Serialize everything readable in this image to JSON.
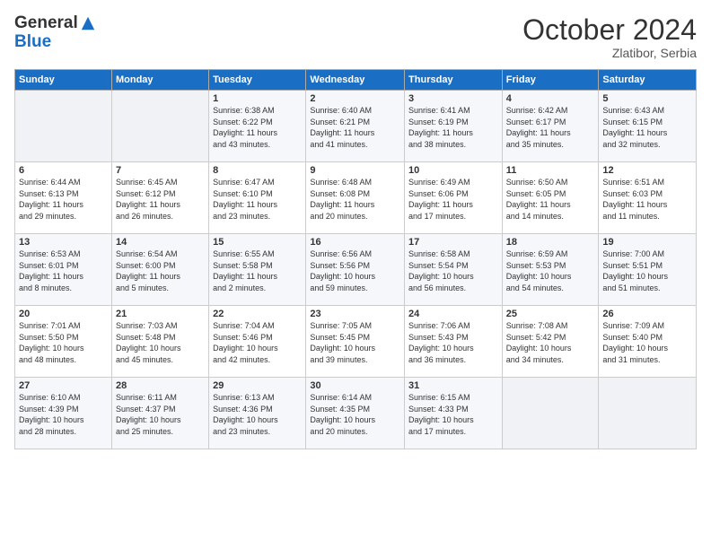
{
  "header": {
    "logo_line1": "General",
    "logo_line2": "Blue",
    "month": "October 2024",
    "location": "Zlatibor, Serbia"
  },
  "days_of_week": [
    "Sunday",
    "Monday",
    "Tuesday",
    "Wednesday",
    "Thursday",
    "Friday",
    "Saturday"
  ],
  "weeks": [
    [
      {
        "day": "",
        "info": ""
      },
      {
        "day": "",
        "info": ""
      },
      {
        "day": "1",
        "info": "Sunrise: 6:38 AM\nSunset: 6:22 PM\nDaylight: 11 hours\nand 43 minutes."
      },
      {
        "day": "2",
        "info": "Sunrise: 6:40 AM\nSunset: 6:21 PM\nDaylight: 11 hours\nand 41 minutes."
      },
      {
        "day": "3",
        "info": "Sunrise: 6:41 AM\nSunset: 6:19 PM\nDaylight: 11 hours\nand 38 minutes."
      },
      {
        "day": "4",
        "info": "Sunrise: 6:42 AM\nSunset: 6:17 PM\nDaylight: 11 hours\nand 35 minutes."
      },
      {
        "day": "5",
        "info": "Sunrise: 6:43 AM\nSunset: 6:15 PM\nDaylight: 11 hours\nand 32 minutes."
      }
    ],
    [
      {
        "day": "6",
        "info": "Sunrise: 6:44 AM\nSunset: 6:13 PM\nDaylight: 11 hours\nand 29 minutes."
      },
      {
        "day": "7",
        "info": "Sunrise: 6:45 AM\nSunset: 6:12 PM\nDaylight: 11 hours\nand 26 minutes."
      },
      {
        "day": "8",
        "info": "Sunrise: 6:47 AM\nSunset: 6:10 PM\nDaylight: 11 hours\nand 23 minutes."
      },
      {
        "day": "9",
        "info": "Sunrise: 6:48 AM\nSunset: 6:08 PM\nDaylight: 11 hours\nand 20 minutes."
      },
      {
        "day": "10",
        "info": "Sunrise: 6:49 AM\nSunset: 6:06 PM\nDaylight: 11 hours\nand 17 minutes."
      },
      {
        "day": "11",
        "info": "Sunrise: 6:50 AM\nSunset: 6:05 PM\nDaylight: 11 hours\nand 14 minutes."
      },
      {
        "day": "12",
        "info": "Sunrise: 6:51 AM\nSunset: 6:03 PM\nDaylight: 11 hours\nand 11 minutes."
      }
    ],
    [
      {
        "day": "13",
        "info": "Sunrise: 6:53 AM\nSunset: 6:01 PM\nDaylight: 11 hours\nand 8 minutes."
      },
      {
        "day": "14",
        "info": "Sunrise: 6:54 AM\nSunset: 6:00 PM\nDaylight: 11 hours\nand 5 minutes."
      },
      {
        "day": "15",
        "info": "Sunrise: 6:55 AM\nSunset: 5:58 PM\nDaylight: 11 hours\nand 2 minutes."
      },
      {
        "day": "16",
        "info": "Sunrise: 6:56 AM\nSunset: 5:56 PM\nDaylight: 10 hours\nand 59 minutes."
      },
      {
        "day": "17",
        "info": "Sunrise: 6:58 AM\nSunset: 5:54 PM\nDaylight: 10 hours\nand 56 minutes."
      },
      {
        "day": "18",
        "info": "Sunrise: 6:59 AM\nSunset: 5:53 PM\nDaylight: 10 hours\nand 54 minutes."
      },
      {
        "day": "19",
        "info": "Sunrise: 7:00 AM\nSunset: 5:51 PM\nDaylight: 10 hours\nand 51 minutes."
      }
    ],
    [
      {
        "day": "20",
        "info": "Sunrise: 7:01 AM\nSunset: 5:50 PM\nDaylight: 10 hours\nand 48 minutes."
      },
      {
        "day": "21",
        "info": "Sunrise: 7:03 AM\nSunset: 5:48 PM\nDaylight: 10 hours\nand 45 minutes."
      },
      {
        "day": "22",
        "info": "Sunrise: 7:04 AM\nSunset: 5:46 PM\nDaylight: 10 hours\nand 42 minutes."
      },
      {
        "day": "23",
        "info": "Sunrise: 7:05 AM\nSunset: 5:45 PM\nDaylight: 10 hours\nand 39 minutes."
      },
      {
        "day": "24",
        "info": "Sunrise: 7:06 AM\nSunset: 5:43 PM\nDaylight: 10 hours\nand 36 minutes."
      },
      {
        "day": "25",
        "info": "Sunrise: 7:08 AM\nSunset: 5:42 PM\nDaylight: 10 hours\nand 34 minutes."
      },
      {
        "day": "26",
        "info": "Sunrise: 7:09 AM\nSunset: 5:40 PM\nDaylight: 10 hours\nand 31 minutes."
      }
    ],
    [
      {
        "day": "27",
        "info": "Sunrise: 6:10 AM\nSunset: 4:39 PM\nDaylight: 10 hours\nand 28 minutes."
      },
      {
        "day": "28",
        "info": "Sunrise: 6:11 AM\nSunset: 4:37 PM\nDaylight: 10 hours\nand 25 minutes."
      },
      {
        "day": "29",
        "info": "Sunrise: 6:13 AM\nSunset: 4:36 PM\nDaylight: 10 hours\nand 23 minutes."
      },
      {
        "day": "30",
        "info": "Sunrise: 6:14 AM\nSunset: 4:35 PM\nDaylight: 10 hours\nand 20 minutes."
      },
      {
        "day": "31",
        "info": "Sunrise: 6:15 AM\nSunset: 4:33 PM\nDaylight: 10 hours\nand 17 minutes."
      },
      {
        "day": "",
        "info": ""
      },
      {
        "day": "",
        "info": ""
      }
    ]
  ]
}
